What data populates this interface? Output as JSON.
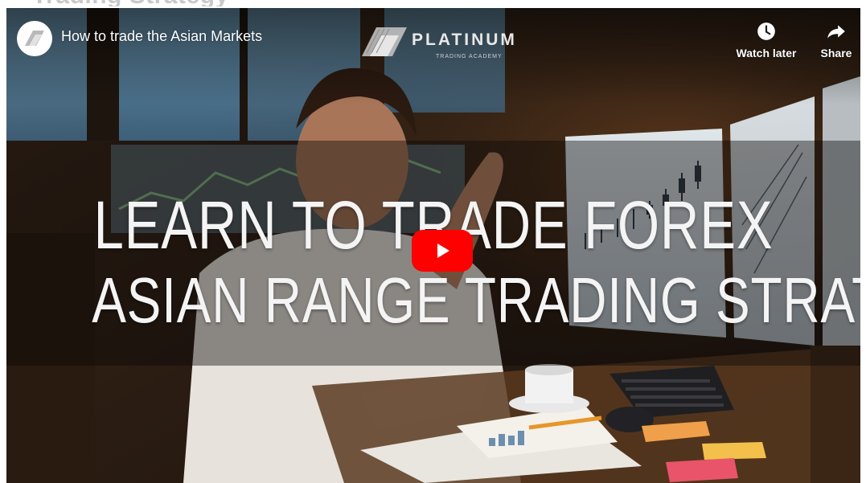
{
  "page": {
    "partial_heading": "Trading Strategy"
  },
  "player": {
    "title": "How to trade the Asian Markets",
    "channel_icon": "platinum-logo-icon",
    "brand": {
      "name": "PLATINUM",
      "subtitle": "TRADING ACADEMY"
    },
    "actions": {
      "watch_later": {
        "label": "Watch later",
        "icon": "clock-icon"
      },
      "share": {
        "label": "Share",
        "icon": "share-arrow-icon"
      }
    },
    "thumbnail": {
      "line1": "LEARN TO TRADE FOREX",
      "line2": "ASIAN RANGE TRADING STRATEGY"
    },
    "play_icon": "play-icon",
    "colors": {
      "play_button": "#ff0000",
      "headline_text": "#f4f4f4"
    }
  }
}
